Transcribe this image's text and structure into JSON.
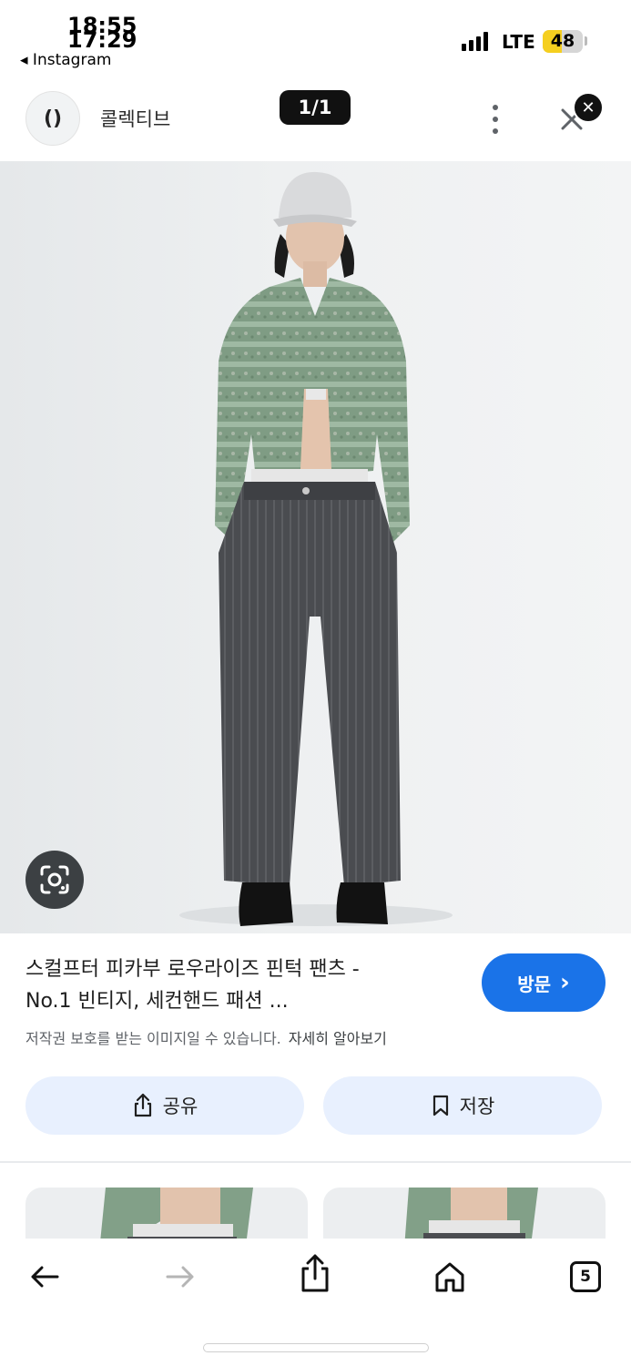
{
  "status_bar": {
    "time_primary": "18:55",
    "time_secondary": "17:29",
    "back_app": "◂ Instagram",
    "carrier": "LTE",
    "battery_level": "48",
    "battery_fraction": 0.48,
    "battery_color": "#f5cf1f"
  },
  "header": {
    "site_logo_text": "()",
    "site_name": "콜렉티브",
    "page_counter": "1/1",
    "more_icon": "more-vert-icon",
    "close_icon": "close-icon",
    "close_badge": "✕"
  },
  "image": {
    "lens_icon": "google-lens-icon"
  },
  "product": {
    "title_line1": "스컬프터 피카부 로우라이즈 핀턱 팬츠 -",
    "title_line2": "No.1 빈티지, 세컨핸드 패션 ...",
    "visit_label": "방문",
    "visit_chevron": "›",
    "copyright_notice": "저작권 보호를 받는 이미지일 수 있습니다.",
    "learn_more": "자세히 알아보기"
  },
  "actions": {
    "share_label": "공유",
    "save_label": "저장"
  },
  "toolbar": {
    "tabs_count": "5"
  },
  "colors": {
    "accent": "#1a73e8",
    "chip_bg": "#e8f0fe",
    "lens_bg": "#3c4043"
  }
}
